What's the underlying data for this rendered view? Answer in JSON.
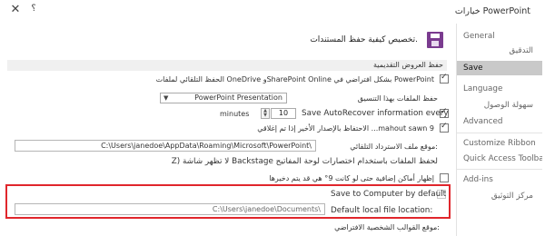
{
  "window": {
    "title": "خيارات PowerPoint",
    "help_label": "؟",
    "close_label": "✕"
  },
  "sidebar": {
    "items": [
      {
        "label": "General"
      },
      {
        "label": "التدقيق"
      },
      {
        "label": "Save"
      },
      {
        "label": "Language"
      },
      {
        "label": "سهولة الوصول"
      },
      {
        "label": "Advanced"
      },
      {
        "label": "Customize Ribbon"
      },
      {
        "label": "Quick Access Toolbar"
      },
      {
        "label": "Add-ins"
      },
      {
        "label": "مركز التوثيق"
      }
    ]
  },
  "main": {
    "heading": "تخصيص كيفية حفظ المستندات.",
    "section1_title": "حفظ العروض التقديمية",
    "autosave_label": "الحفظ التلقائي لملفات OneDrive وSharePoint Online بشكل افتراضي في PowerPoint",
    "save_format_label": "حفظ الملفات بهذا التنسيق",
    "save_format_value": "PowerPoint Presentation",
    "autorecover_prefix": "Save AutoRecover information every",
    "autorecover_minutes": "10",
    "autorecover_suffix": "minutes",
    "keep_last_label": "الاحتفاظ بالإصدار الأخير إذا تم إغلاقي ...mahout sawn 9",
    "autorecover_location_label": "موقع ملف الاسترداد التلقائي:",
    "autorecover_location_value": "C:\\Users\\janedoe\\AppData\\Roaming\\Microsoft\\PowerPoint\\",
    "backstage_label": "Z) لا تظهر شاشة Backstage لحفظ الملفات باستخدام اختصارات لوحة المفاتيح",
    "show_additional_label": "إظهار أماكن إضافية حتى لو كانت 9° هي قد يتم دخيرها",
    "save_to_computer_label": "Save to Computer by default",
    "default_local_label": "Default local file location:",
    "default_local_value": "C:\\Users\\janedoe\\Documents\\",
    "default_template_label": "موقع القوالب الشخصية الافتراضي:"
  },
  "colors": {
    "highlight": "#e0262c",
    "save_icon": "#7a3b8f",
    "sidebar_active": "#c9c9c9"
  },
  "icons": {
    "save": "save-icon",
    "dropdown": "chevron-down-icon"
  }
}
